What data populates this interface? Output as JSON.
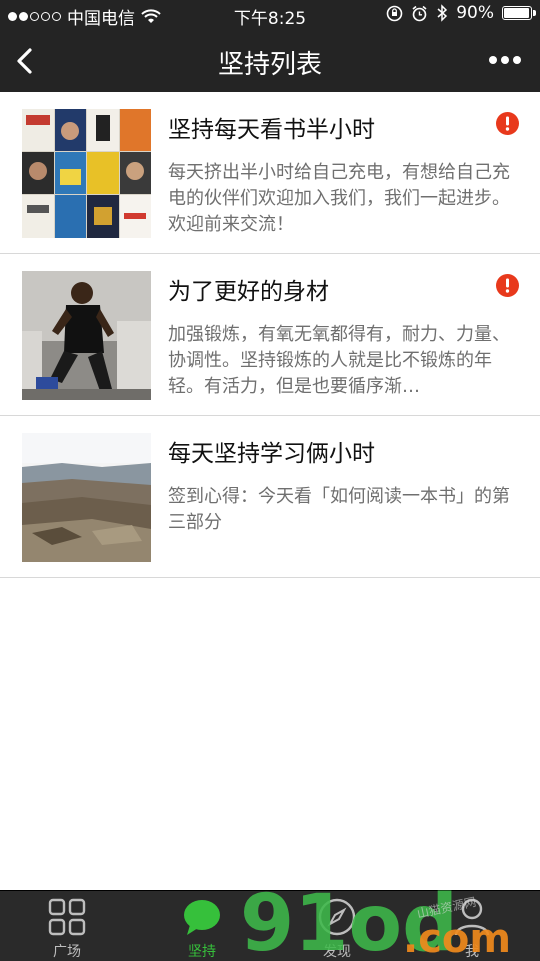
{
  "status_bar": {
    "carrier": "中国电信",
    "time": "下午8:25",
    "battery": "90%"
  },
  "navbar": {
    "title": "坚持列表"
  },
  "list": [
    {
      "title": "坚持每天看书半小时",
      "desc": "每天挤出半小时给自己充电，有想给自己充电的伙伴们欢迎加入我们，我们一起进步。欢迎前来交流！",
      "thumb": "books-cover-grid"
    },
    {
      "title": "为了更好的身材",
      "desc": "加强锻炼，有氧无氧都得有，耐力、力量、协调性。坚持锻炼的人就是比不锻炼的年轻。有活力，但是也要循序渐…",
      "thumb": "gym-athlete-photo"
    },
    {
      "title": "每天坚持学习俩小时",
      "desc": "签到心得：今天看「如何阅读一本书」的第三部分",
      "thumb": "canyon-landscape-photo"
    }
  ],
  "tabbar": {
    "items": [
      {
        "label": "广场",
        "icon": "grid-icon"
      },
      {
        "label": "坚持",
        "icon": "chat-bubble-icon"
      },
      {
        "label": "发现",
        "icon": "compass-icon"
      },
      {
        "label": "我",
        "icon": "person-icon"
      }
    ]
  },
  "watermark": {
    "main": "91od",
    "suffix": ".com",
    "tagline": "山猫资源网"
  },
  "colors": {
    "bar_bg": "#242424",
    "accent_green": "#36c03b",
    "alert_red": "#e8391c",
    "desc_gray": "#6f6f6f"
  }
}
